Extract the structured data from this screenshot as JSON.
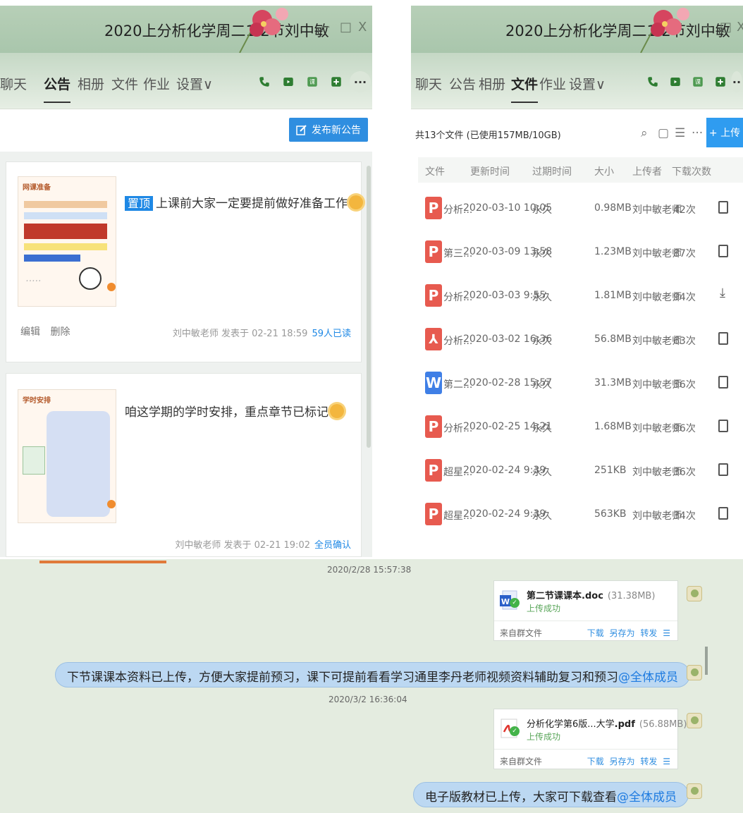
{
  "left": {
    "title": "2020上分析化学周二1-2节刘中敏",
    "tabs": [
      "聊天",
      "公告",
      "相册",
      "文件",
      "作业",
      "设置∨"
    ],
    "active_tab": 1,
    "window_controls": [
      "−",
      "□",
      "X"
    ],
    "publish_label": "发布新公告",
    "notices": [
      {
        "thumb_title": "网课准备",
        "pin_label": "置顶",
        "text": "上课前大家一定要提前做好准备工作",
        "actions": [
          "编辑",
          "删除"
        ],
        "meta": "刘中敏老师 发表于 02-21 18:59",
        "status": "59人已读"
      },
      {
        "thumb_title": "学时安排",
        "pin_label": "",
        "text": "咱这学期的学时安排，重点章节已标记",
        "actions": [],
        "meta": "刘中敏老师 发表于 02-21 19:02",
        "status": "全员确认"
      }
    ]
  },
  "right": {
    "title": "2020上分析化学周二1-2节刘中敏",
    "tabs": [
      "聊天",
      "公告",
      "相册",
      "文件",
      "作业",
      "设置∨"
    ],
    "active_tab": 3,
    "summary": "共13个文件 (已使用157MB/10GB)",
    "upload_label": "+ 上传",
    "columns": [
      "文件",
      "更新时间",
      "过期时间",
      "大小",
      "上传者",
      "下载次数"
    ],
    "files": [
      {
        "icon": "ppt-icon",
        "name": "分析...",
        "time": "2020-03-10 10:05",
        "expire": "永久",
        "size": "0.98MB",
        "uploader": "刘中敏老师",
        "downloads": "42次",
        "action": "file-icon"
      },
      {
        "icon": "ppt-icon",
        "name": "第三...",
        "time": "2020-03-09 13:58",
        "expire": "永久",
        "size": "1.23MB",
        "uploader": "刘中敏老师",
        "downloads": "87次",
        "action": "file-icon"
      },
      {
        "icon": "ppt-icon",
        "name": "分析...",
        "time": "2020-03-03 9:55",
        "expire": "永久",
        "size": "1.81MB",
        "uploader": "刘中敏老师",
        "downloads": "94次",
        "action": "download-icon"
      },
      {
        "icon": "pdf-icon",
        "name": "分析...",
        "time": "2020-03-02 16:36",
        "expire": "永久",
        "size": "56.8MB",
        "uploader": "刘中敏老师",
        "downloads": "63次",
        "action": "file-icon"
      },
      {
        "icon": "word-icon",
        "name": "第二...",
        "time": "2020-02-28 15:57",
        "expire": "永久",
        "size": "31.3MB",
        "uploader": "刘中敏老师",
        "downloads": "56次",
        "action": "file-icon"
      },
      {
        "icon": "ppt-icon",
        "name": "分析...",
        "time": "2020-02-25 14:21",
        "expire": "永久",
        "size": "1.68MB",
        "uploader": "刘中敏老师",
        "downloads": "96次",
        "action": "file-icon"
      },
      {
        "icon": "ppt-icon",
        "name": "超星...",
        "time": "2020-02-24 9:39",
        "expire": "永久",
        "size": "251KB",
        "uploader": "刘中敏老师",
        "downloads": "36次",
        "action": "file-icon"
      },
      {
        "icon": "ppt-icon",
        "name": "超星...",
        "time": "2020-02-24 9:39",
        "expire": "永久",
        "size": "563KB",
        "uploader": "刘中敏老师",
        "downloads": "34次",
        "action": "file-icon"
      }
    ]
  },
  "chat": {
    "time1": "2020/2/28 15:57:38",
    "file1": {
      "name_prefix": "第二节课课本",
      "name_ext": ".doc",
      "size": "(31.38MB)",
      "status": "上传成功",
      "from": "来自群文件",
      "actions": [
        "下载",
        "另存为",
        "转发"
      ]
    },
    "msg1": "下节课课本资料已上传，方便大家提前预习，课下可提前看看学习通里李丹老师视频资料辅助复习和预习",
    "msg1_at": "@全体成员",
    "time2": "2020/3/2 16:36:04",
    "file2": {
      "name_prefix": "分析化学第6版...大学",
      "name_ext": ".pdf",
      "size": "(56.88MB)",
      "status": "上传成功",
      "from": "来自群文件",
      "actions": [
        "下载",
        "另存为",
        "转发"
      ]
    },
    "msg2": "电子版教材已上传，大家可下载查看",
    "msg2_at": "@全体成员"
  }
}
